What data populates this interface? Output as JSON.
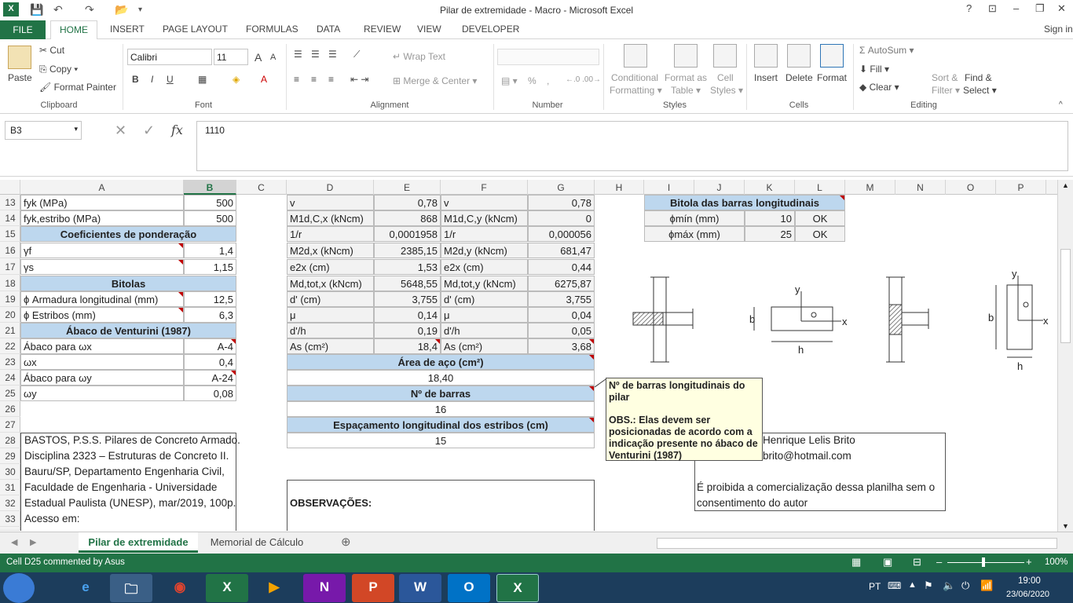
{
  "window": {
    "title": "Pilar de extremidade - Macro - Microsoft Excel",
    "sign_in": "Sign in",
    "help": "?",
    "minimize": "–",
    "restore": "❐",
    "close": "✕"
  },
  "ribbon_tabs": [
    "FILE",
    "HOME",
    "INSERT",
    "PAGE LAYOUT",
    "FORMULAS",
    "DATA",
    "REVIEW",
    "VIEW",
    "DEVELOPER"
  ],
  "ribbon": {
    "clipboard": {
      "paste": "Paste",
      "cut": "Cut",
      "copy": "Copy",
      "format_painter": "Format Painter",
      "label": "Clipboard"
    },
    "font": {
      "name": "Calibri",
      "size": "11",
      "label": "Font",
      "bold": "B",
      "italic": "I",
      "underline": "U",
      "grow": "A",
      "shrink": "A"
    },
    "alignment": {
      "wrap": "Wrap Text",
      "merge": "Merge & Center",
      "label": "Alignment"
    },
    "number": {
      "label": "Number",
      "percent": "%",
      "comma": ","
    },
    "styles": {
      "conditional": "Conditional",
      "conditional2": "Formatting",
      "format_as": "Format as",
      "format_as2": "Table",
      "cell_styles": "Cell",
      "cell_styles2": "Styles",
      "label": "Styles"
    },
    "cells": {
      "insert": "Insert",
      "delete": "Delete",
      "format": "Format",
      "label": "Cells"
    },
    "editing": {
      "autosum": "AutoSum",
      "fill": "Fill",
      "clear": "Clear",
      "sort": "Sort &",
      "sort2": "Filter",
      "find": "Find &",
      "find2": "Select",
      "label": "Editing"
    }
  },
  "formula_bar": {
    "name_box": "B3",
    "formula": "1110",
    "fx": "fx"
  },
  "columns": [
    "A",
    "B",
    "C",
    "D",
    "E",
    "F",
    "G",
    "H",
    "I",
    "J",
    "K",
    "L",
    "M",
    "N",
    "O",
    "P"
  ],
  "rows": [
    "13",
    "14",
    "15",
    "16",
    "17",
    "18",
    "19",
    "20",
    "21",
    "22",
    "23",
    "24",
    "25",
    "26",
    "27",
    "28",
    "29",
    "30",
    "31",
    "32",
    "33",
    "34"
  ],
  "sheet": {
    "a13": "fyk (MPa)",
    "b13": "500",
    "a14": "fyk,estribo (MPa)",
    "b14": "500",
    "a15": "Coeficientes de ponderação",
    "a16": "γf",
    "b16": "1,4",
    "a17": "γs",
    "b17": "1,15",
    "a18": "Bitolas",
    "a19": "ϕ Armadura longitudinal (mm)",
    "b19": "12,5",
    "a20": "ϕ Estribos (mm)",
    "b20": "6,3",
    "a21": "Ábaco de Venturini (1987)",
    "a22": "Ábaco para ωx",
    "b22": "A-4",
    "a23": "ωx",
    "b23": "0,4",
    "a24": "Ábaco para ωy",
    "b24": "A-24",
    "a25": "ωy",
    "b25": "0,08",
    "a28": "BASTOS, P.S.S. Pilares de Concreto Armado.",
    "a29": "Disciplina 2323 – Estruturas de Concreto II.",
    "a30": "Bauru/SP, Departamento Engenharia Civil,",
    "a31": "Faculdade de Engenharia - Universidade",
    "a32": "Estadual Paulista (UNESP), mar/2019, 100p.",
    "a33": "Acesso em:",
    "d13": "v",
    "e13": "0,78",
    "f13": "v",
    "g13": "0,78",
    "d14": "M1d,C,x (kNcm)",
    "e14": "868",
    "f14": "M1d,C,y (kNcm)",
    "g14": "0",
    "d15": "1/r",
    "e15": "0,0001958",
    "f15": "1/r",
    "g15": "0,000056",
    "d16": "M2d,x (kNcm)",
    "e16": "2385,15",
    "f16": "M2d,y (kNcm)",
    "g16": "681,47",
    "d17": "e2x (cm)",
    "e17": "1,53",
    "f17": "e2x (cm)",
    "g17": "0,44",
    "d18": "Md,tot,x (kNcm)",
    "e18": "5648,55",
    "f18": "Md,tot,y (kNcm)",
    "g18": "6275,87",
    "d19": "d' (cm)",
    "e19": "3,755",
    "f19": "d' (cm)",
    "g19": "3,755",
    "d20": "μ",
    "e20": "0,14",
    "f20": "μ",
    "g20": "0,04",
    "d21": "d'/h",
    "e21": "0,19",
    "f21": "d'/h",
    "g21": "0,05",
    "d22": "As (cm²)",
    "e22": "18,4",
    "f22": "As (cm²)",
    "g22": "3,68",
    "d23": "Área de aço (cm²)",
    "d24": "18,40",
    "d25": "Nº de barras",
    "d26": "16",
    "d27": "Espaçamento longitudinal dos estribos (cm)",
    "d28": "15",
    "d32": "OBSERVAÇÕES:",
    "i13": "Bitola das barras longitudinais",
    "i14": "ϕmín (mm)",
    "k14": "10",
    "l14": "OK",
    "i15": "ϕmáx (mm)",
    "k15": "25",
    "l15": "OK",
    "j28": "Henrique Lelis Brito",
    "j29": "brito@hotmail.com",
    "j31": "É proibida a comercialização dessa planilha sem o",
    "j32": "consentimento do autor"
  },
  "comment": {
    "line1": "Nº de barras longitudinais do pilar",
    "line2": "OBS.: Elas devem ser posicionadas de acordo com a indicação presente no ábaco de Venturini (1987)"
  },
  "diagram": {
    "b": "b",
    "h": "h",
    "x": "x",
    "y": "y"
  },
  "sheet_tabs": [
    "Pilar de extremidade",
    "Memorial de Cálculo"
  ],
  "status": {
    "text": "Cell D25 commented by Asus",
    "zoom": "100%"
  },
  "taskbar": {
    "lang": "PT",
    "time": "19:00",
    "date": "23/06/2020"
  },
  "colors": {
    "excel_green": "#217346",
    "header_blue": "#bdd7ee",
    "taskbar": "#1c3d5c"
  }
}
